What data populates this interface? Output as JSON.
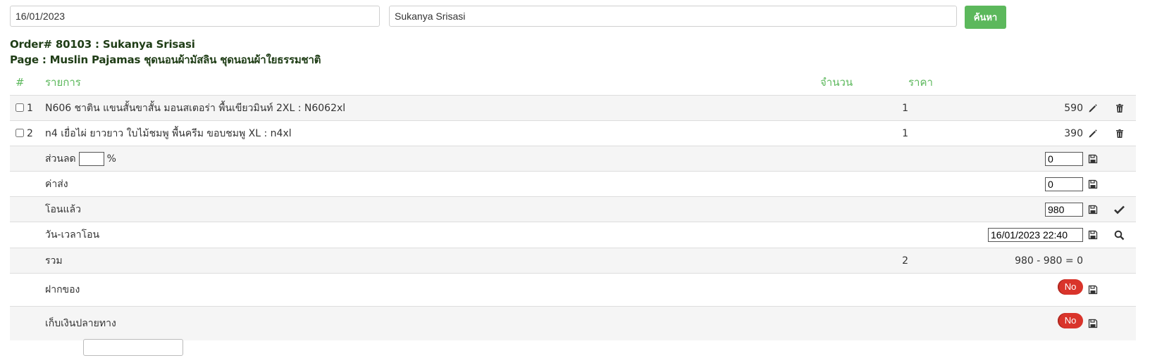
{
  "search": {
    "date_value": "16/01/2023",
    "name_value": "Sukanya Srisasi",
    "button_label": "ค้นหา"
  },
  "order": {
    "order_line": "Order# 80103 : Sukanya Srisasi",
    "page_line": "Page : Muslin Pajamas ชุดนอนผ้ามัสลิน ชุดนอนผ้าใยธรรมชาติ"
  },
  "table": {
    "headers": {
      "num": "#",
      "item": "รายการ",
      "qty": "จำนวน",
      "price": "ราคา"
    },
    "items": [
      {
        "num": "1",
        "desc": "N606 ชาติน แขนสั้นขาสั้น มอนสเตอร่า พื้นเขียวมินท์ 2XL : N6062xl",
        "qty": "1",
        "price": "590"
      },
      {
        "num": "2",
        "desc": "n4 เยื่อไผ่ ยาวยาว ใบไม้ชมพู พื้นครีม ขอบชมพู XL : n4xl",
        "qty": "1",
        "price": "390"
      }
    ],
    "discount": {
      "label": "ส่วนลด",
      "percent_value": "",
      "percent_sign": "%",
      "value": "0"
    },
    "shipping": {
      "label": "ค่าส่ง",
      "value": "0"
    },
    "transferred": {
      "label": "โอนแล้ว",
      "value": "980"
    },
    "transfer_time": {
      "label": "วัน-เวลาโอน",
      "value": "16/01/2023 22:40"
    },
    "total": {
      "label": "รวม",
      "qty": "2",
      "value": "980 - 980 = 0"
    },
    "deposit": {
      "label": "ฝากของ",
      "toggle": "No"
    },
    "cod": {
      "label": "เก็บเงินปลายทาง",
      "toggle": "No"
    }
  },
  "colors": {
    "accent_green": "#5cb85c",
    "heading_dark": "#1f3d16",
    "toggle_red": "#d9342b",
    "stripe": "#f5f5f5"
  }
}
